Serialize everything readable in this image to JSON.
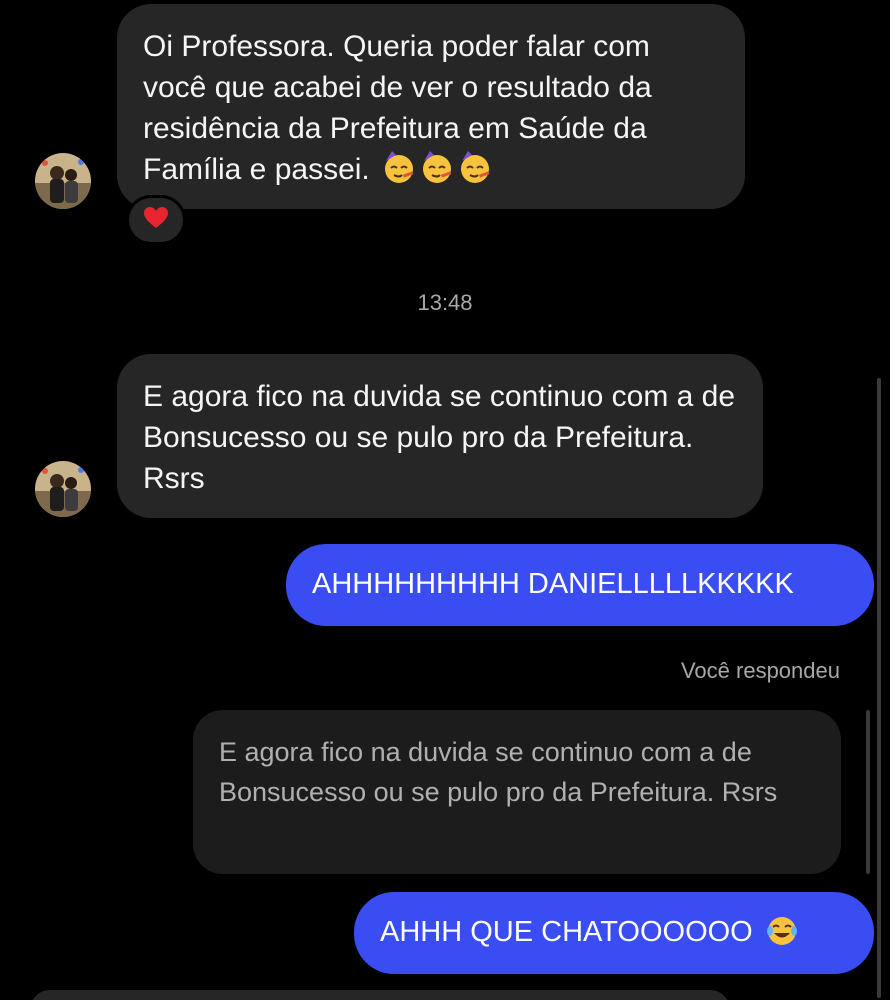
{
  "messages": {
    "first": {
      "text": "Oi Professora. Queria poder falar com você que acabei de ver o resultado da residência da Prefeitura em Saúde da Família e passei.",
      "emojis": [
        "partying-face-icon",
        "partying-face-icon",
        "partying-face-icon"
      ],
      "reaction": "heart-icon"
    },
    "timestamp": "13:48",
    "second": {
      "text": "E agora fico na duvida se continuo com a de Bonsucesso ou se pulo pro da Prefeitura. Rsrs"
    },
    "reply_one": {
      "text": "AHHHHHHHHH DANIELLLLLKKKKK"
    },
    "reply_label": "Você respondeu",
    "quoted": {
      "text": "E agora fico na duvida se continuo com a de Bonsucesso ou se pulo pro da Prefeitura. Rsrs"
    },
    "reply_two": {
      "text": "AHHH QUE CHATOOOOOO",
      "emoji": "tears-of-joy-icon"
    }
  },
  "colors": {
    "background": "#000000",
    "incoming_bubble": "#262626",
    "outgoing_bubble": "#3a4df2",
    "quote_bubble": "#1c1c1c",
    "muted_text": "#a8a8a8"
  }
}
